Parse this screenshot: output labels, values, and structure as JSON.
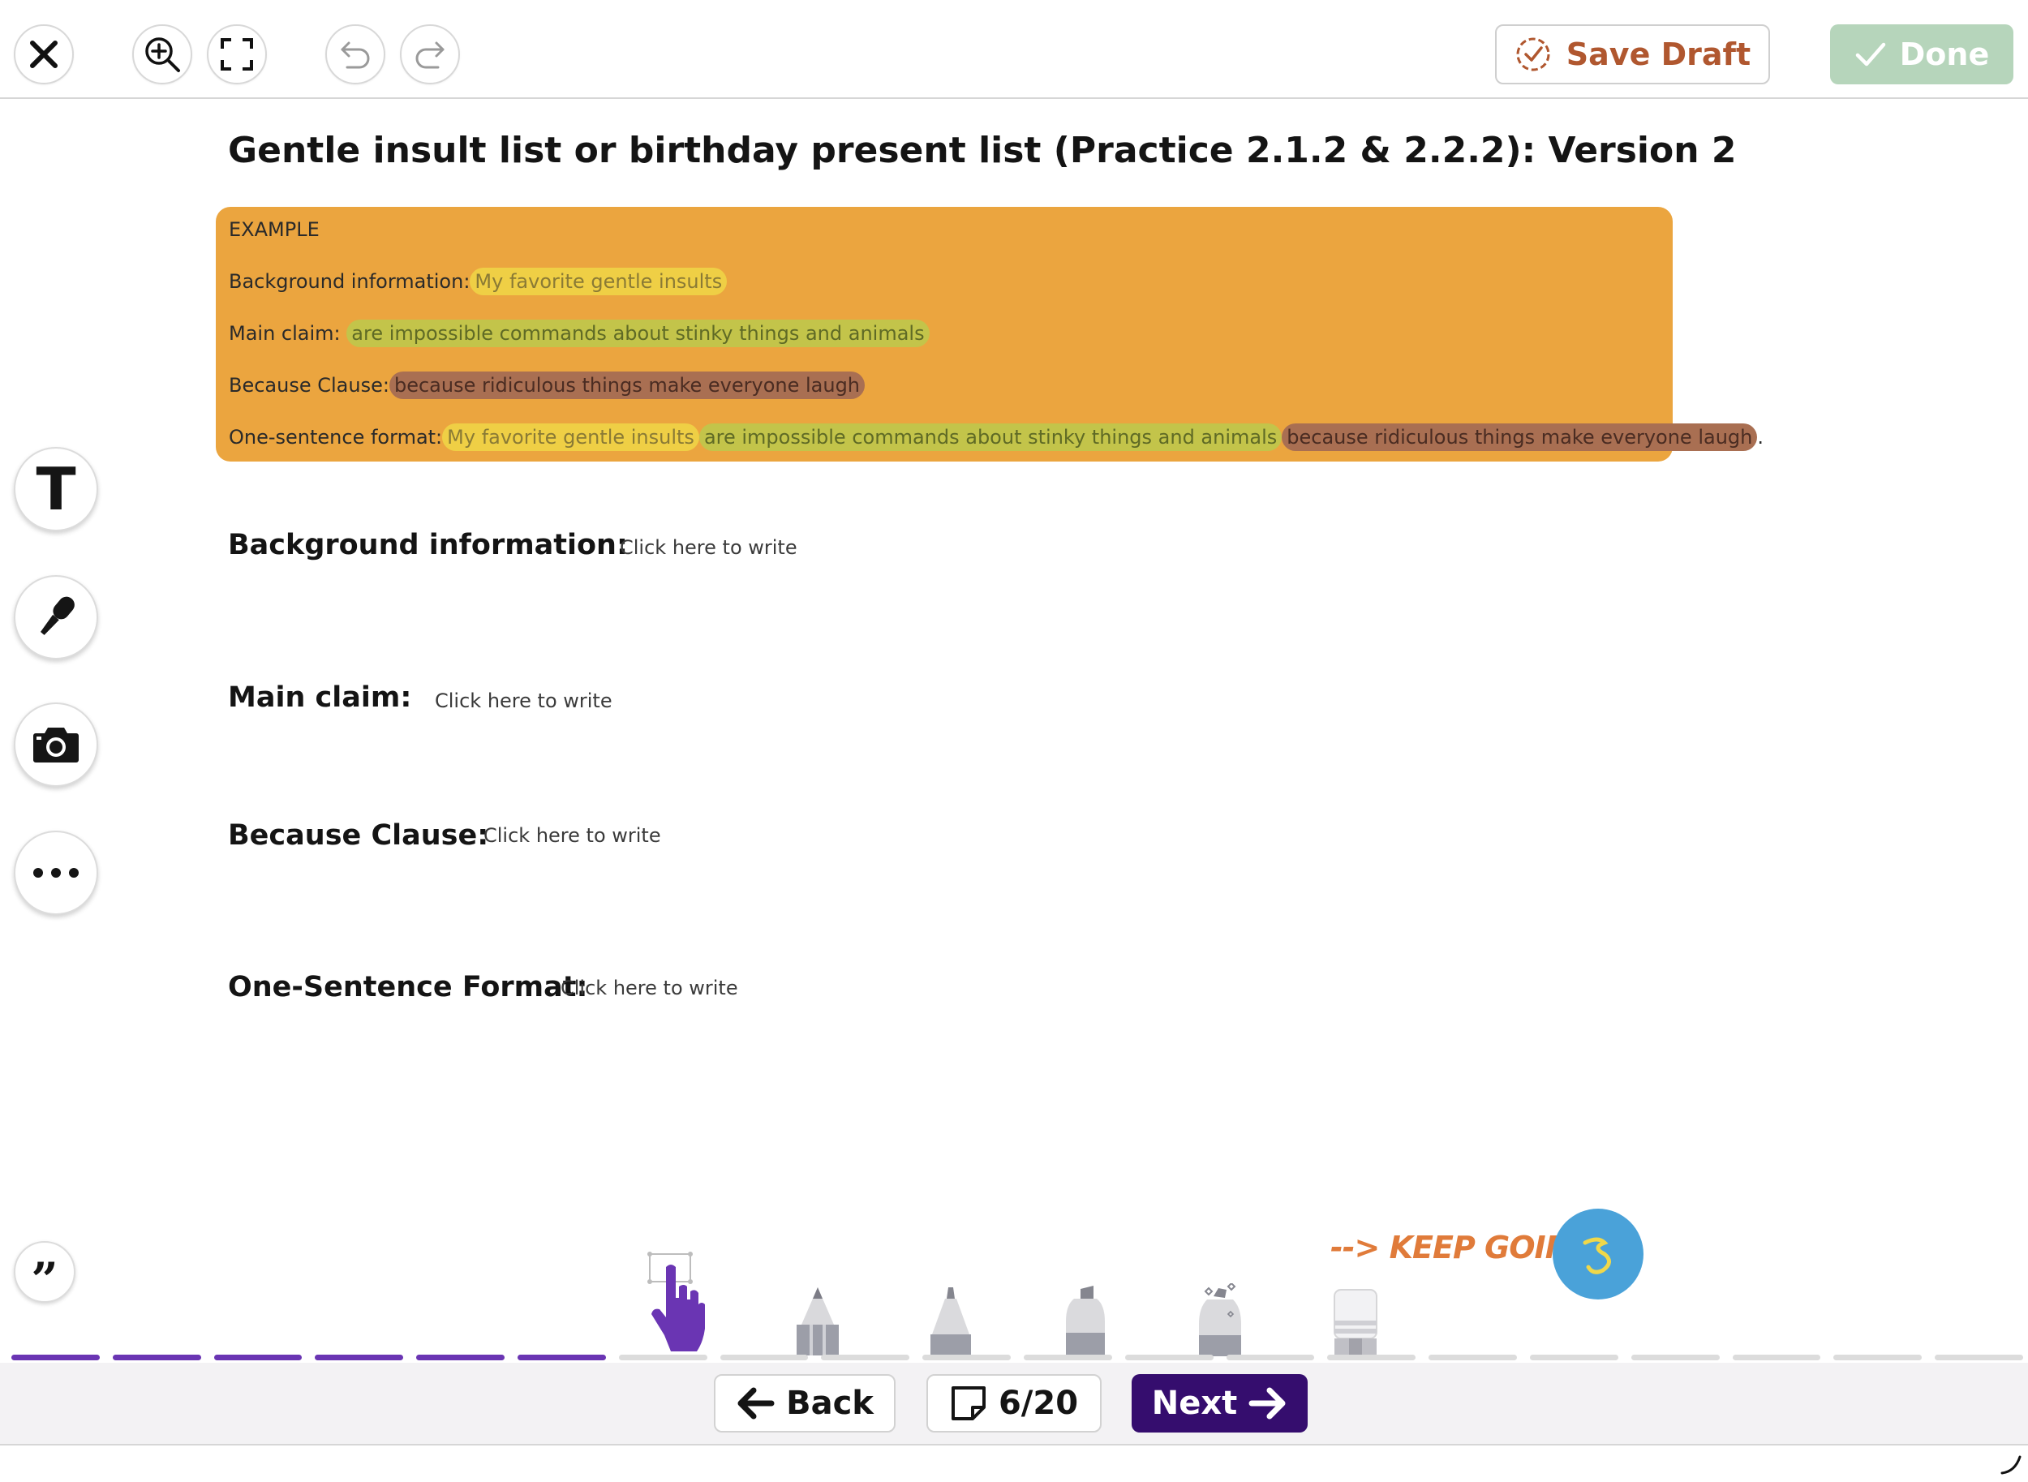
{
  "toolbar": {
    "close_icon": "close-icon",
    "zoom_icon": "zoom-in-icon",
    "fullscreen_icon": "fullscreen-icon",
    "undo_icon": "undo-icon",
    "redo_icon": "redo-icon",
    "save_draft_label": "Save Draft",
    "done_label": "Done"
  },
  "page": {
    "title": "Gentle insult list or birthday present list (Practice 2.1.2 & 2.2.2): Version 2"
  },
  "example": {
    "heading": "EXAMPLE",
    "background_label": "Background information:",
    "background_value": "My favorite gentle insults",
    "main_claim_label": "Main claim:",
    "main_claim_value": "are impossible commands about stinky things and animals",
    "because_label": "Because Clause:",
    "because_value": "because ridiculous things make everyone laugh",
    "one_sentence_label": "One-sentence format:",
    "one_sentence_part1": "My favorite gentle insults",
    "one_sentence_part2": "are impossible commands about stinky things and animals",
    "one_sentence_part3": "because ridiculous things make everyone laugh",
    "one_sentence_end": ".",
    "box_color": "#eba53f"
  },
  "fields": [
    {
      "label": "Background information:",
      "placeholder": "Click here to write"
    },
    {
      "label": "Main claim:",
      "placeholder": "Click here to write"
    },
    {
      "label": "Because Clause:",
      "placeholder": "Click here to write"
    },
    {
      "label": "One-Sentence Format:",
      "placeholder": "Click here to write"
    }
  ],
  "side_tools": {
    "text_tool_label": "T",
    "mic_icon": "microphone-icon",
    "camera_icon": "camera-icon",
    "more_icon": "more-icon",
    "quote_label": "”"
  },
  "drawing_tools": [
    "hand-pointer-tool",
    "pencil-tool",
    "pen-tool",
    "marker-tool",
    "glitter-tool",
    "eraser-tool"
  ],
  "encouragement": {
    "text": "--> KEEP GOING!",
    "badge_color": "#4aa2d9"
  },
  "progress": {
    "completed": 6,
    "total": 20,
    "active_color": "#6a35b3",
    "inactive_color": "#dcdcdc"
  },
  "footer": {
    "back_label": "Back",
    "page_indicator": "6/20",
    "next_label": "Next",
    "next_color": "#350d6e"
  },
  "colors": {
    "save_draft_text": "#b0572f",
    "done_bg": "#b6d5bb"
  }
}
